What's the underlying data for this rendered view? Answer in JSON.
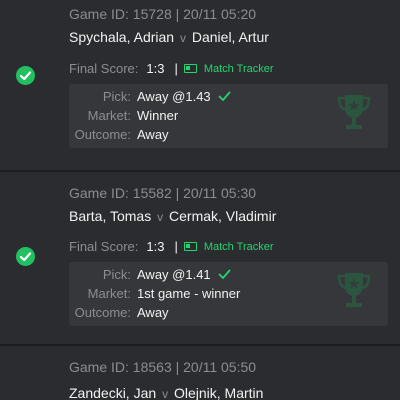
{
  "colors": {
    "background": "#2b2c30",
    "card_inner": "#36373b",
    "accent_green": "#27d36f",
    "muted_text": "#8c8d91",
    "primary_text": "#f2f2f2"
  },
  "icons": {
    "status": "check-circle-icon",
    "tracker": "match-tracker-icon",
    "pick_result": "checkmark-icon",
    "watermark": "trophy-icon"
  },
  "games": [
    {
      "game_id": "Game ID: 15728 | 20/11 05:20",
      "player1": "Spychala, Adrian",
      "vs": "v",
      "player2": "Daniel, Artur",
      "final_score_label": "Final Score:",
      "final_score": "1:3",
      "separator": "|",
      "tracker_label": "Match Tracker",
      "pick_label": "Pick:",
      "pick_value": "Away @1.43",
      "market_label": "Market:",
      "market_value": "Winner",
      "outcome_label": "Outcome:",
      "outcome_value": "Away"
    },
    {
      "game_id": "Game ID: 15582 | 20/11 05:30",
      "player1": "Barta, Tomas",
      "vs": "v",
      "player2": "Cermak, Vladimir",
      "final_score_label": "Final Score:",
      "final_score": "1:3",
      "separator": "|",
      "tracker_label": "Match Tracker",
      "pick_label": "Pick:",
      "pick_value": "Away @1.41",
      "market_label": "Market:",
      "market_value": "1st game - winner",
      "outcome_label": "Outcome:",
      "outcome_value": "Away"
    },
    {
      "game_id": "Game ID: 18563 | 20/11 05:50",
      "player1": "Zandecki, Jan",
      "vs": "v",
      "player2": "Olejnik, Martin"
    }
  ]
}
